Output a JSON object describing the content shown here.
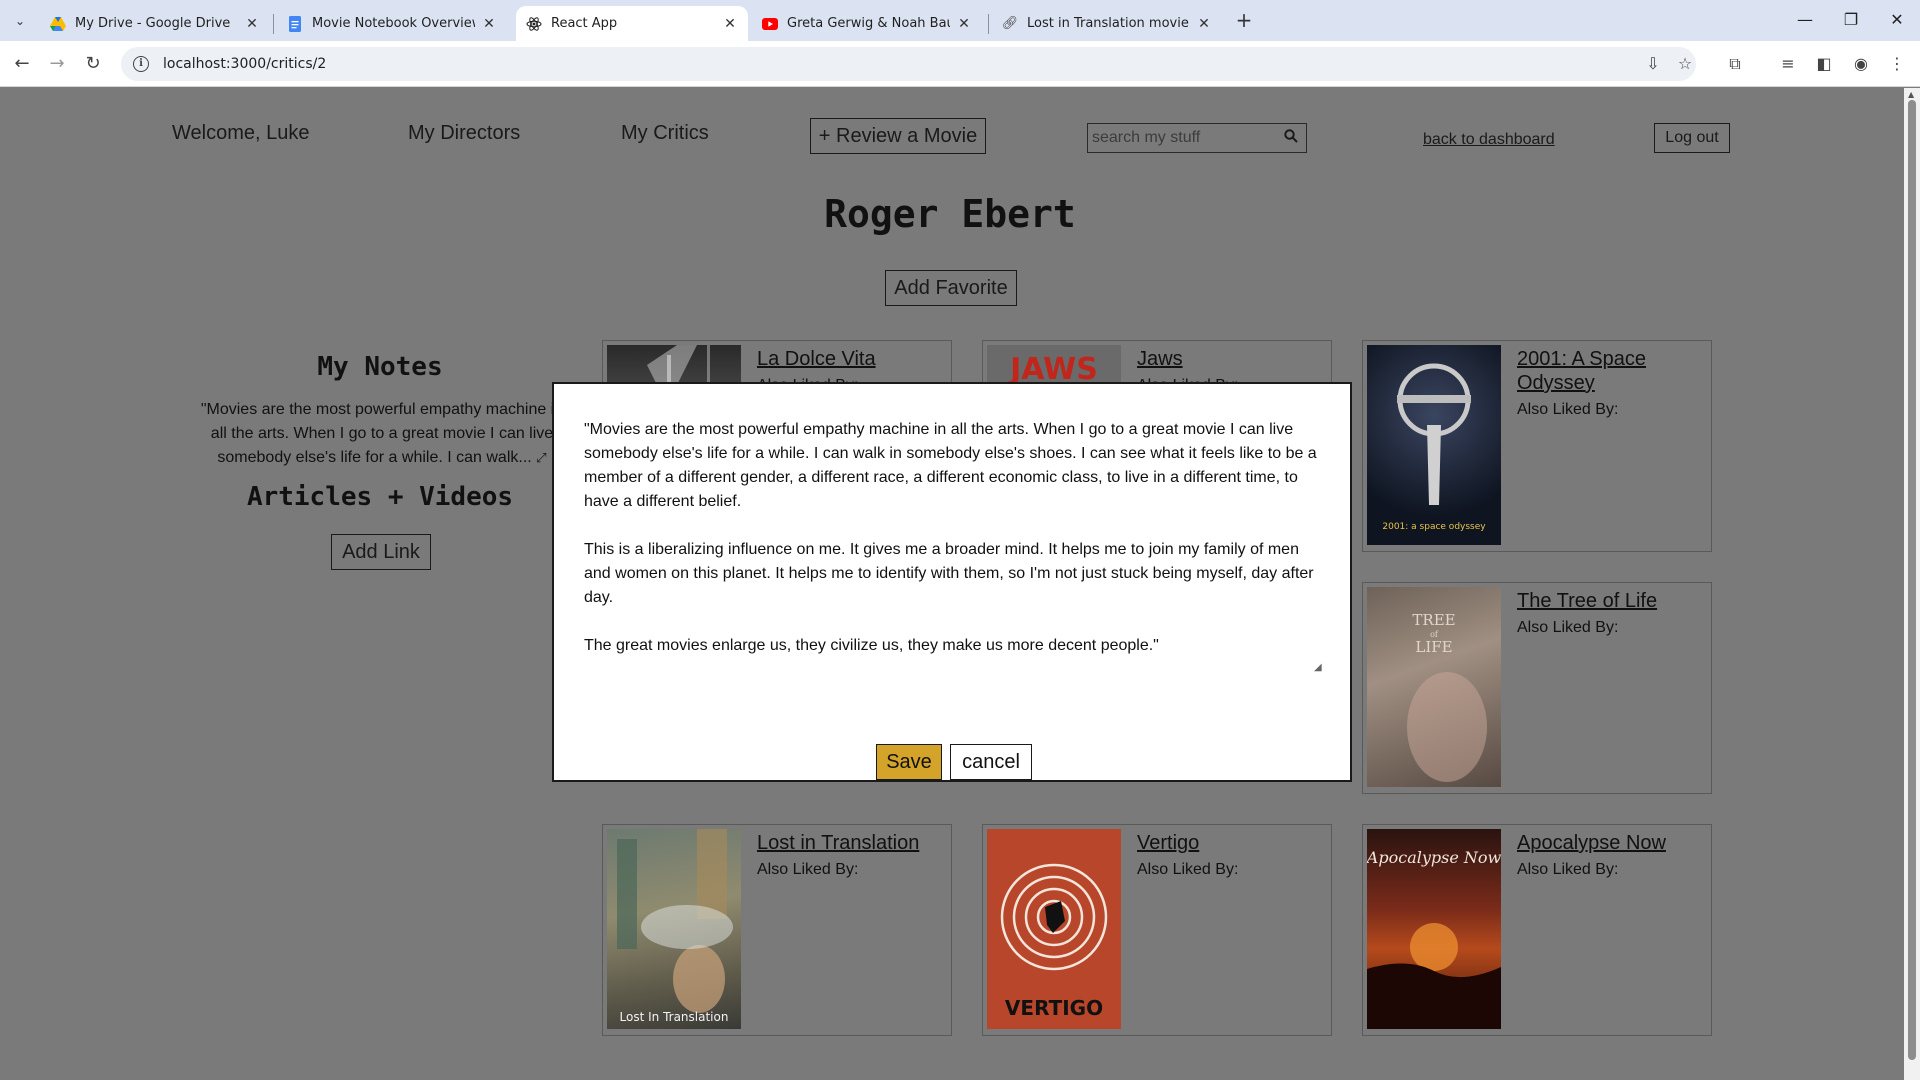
{
  "browser": {
    "tabs": [
      {
        "title": "My Drive - Google Drive",
        "icon": "google-drive-icon"
      },
      {
        "title": "Movie Notebook Overview - Go",
        "icon": "google-docs-icon"
      },
      {
        "title": "React App",
        "icon": "react-icon"
      },
      {
        "title": "Greta Gerwig & Noah Baumbac",
        "icon": "youtube-icon"
      },
      {
        "title": "Lost in Translation movie review",
        "icon": "link-icon"
      }
    ],
    "url": "localhost:3000/critics/2"
  },
  "nav": {
    "welcome": "Welcome, Luke",
    "directors": "My Directors",
    "critics": "My Critics",
    "review_button": "+ Review a Movie",
    "search_placeholder": "search my stuff",
    "back_link": "back to dashboard",
    "logout": "Log out"
  },
  "critic": {
    "name": "Roger Ebert",
    "add_favorite": "Add Favorite"
  },
  "notes": {
    "heading": "My Notes",
    "preview": "\"Movies are the most powerful empathy machine in all the arts. When I go to a great movie I can live somebody else's life for a while. I can walk...",
    "articles_heading": "Articles + Videos",
    "add_link": "Add Link"
  },
  "movies": [
    {
      "title": "La Dolce Vita",
      "liked_label": "Also Liked By:",
      "poster": "la-dolce-vita"
    },
    {
      "title": "Jaws",
      "liked_label": "Also Liked By:",
      "poster": "jaws",
      "poster_text": "JAWS"
    },
    {
      "title": "2001: A Space Odyssey",
      "liked_label": "Also Liked By:",
      "poster": "2001",
      "poster_text": "2001: a space odyssey"
    },
    {
      "title": "The Tree of Life",
      "liked_label": "Also Liked By:",
      "poster": "tree-of-life",
      "poster_text": "TREE of LIFE"
    },
    {
      "title": "Lost in Translation",
      "liked_label": "Also Liked By:",
      "poster": "lost-in-translation",
      "poster_text": "Lost In Translation"
    },
    {
      "title": "Vertigo",
      "liked_label": "Also Liked By:",
      "poster": "vertigo",
      "poster_text": "VERTIGO"
    },
    {
      "title": "Apocalypse Now",
      "liked_label": "Also Liked By:",
      "poster": "apocalypse-now",
      "poster_text": "Apocalypse Now"
    }
  ],
  "modal": {
    "text": "\"Movies are the most powerful empathy machine in all the arts. When I go to a great movie I can live somebody else's life for a while. I can walk in somebody else's shoes. I can see what it feels like to be a member of a different gender, a different race, a different economic class, to live in a different time, to have a different belief.\n\nThis is a liberalizing influence on me. It gives me a broader mind. It helps me to join my family of men and women on this planet. It helps me to identify with them, so I'm not just stuck being myself, day after day.\n\nThe great movies enlarge us, they civilize us, they make us more decent people.\"",
    "save": "Save",
    "cancel": "cancel"
  },
  "colors": {
    "overlay": "#7a7a7a",
    "save_button": "#d3a32a",
    "tabbar": "#dbe3f2"
  }
}
